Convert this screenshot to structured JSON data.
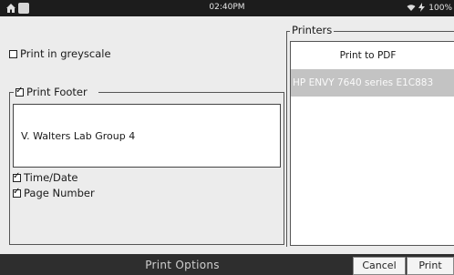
{
  "status_bar": {
    "time": "02:40PM",
    "battery": "100%"
  },
  "options": {
    "greyscale_label": "Print in greyscale",
    "greyscale_checked": false,
    "footer_label": "Print Footer",
    "footer_checked": true,
    "footer_text": "V. Walters Lab Group 4",
    "time_date_label": "Time/Date",
    "time_date_checked": true,
    "page_number_label": "Page Number",
    "page_number_checked": true
  },
  "printers": {
    "label": "Printers",
    "items": [
      {
        "name": "Print to PDF"
      },
      {
        "name": "HP ENVY 7640 series E1C883"
      }
    ]
  },
  "bottom_bar": {
    "title": "Print Options",
    "cancel_label": "Cancel",
    "print_label": "Print"
  }
}
